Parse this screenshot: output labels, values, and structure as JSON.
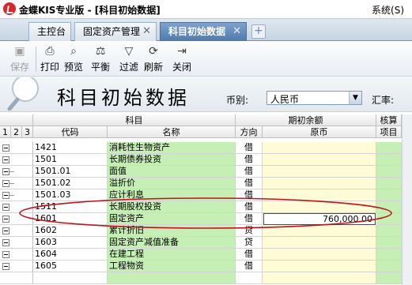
{
  "window": {
    "title": "金蝶KIS专业版 - [科目初始数据]",
    "system_menu": "系统(S)"
  },
  "tabs": [
    {
      "label": "主控台",
      "closable": false,
      "active": false
    },
    {
      "label": "固定资产管理",
      "closable": true,
      "active": false
    },
    {
      "label": "科目初始数据",
      "closable": true,
      "active": true
    }
  ],
  "toolbar": {
    "buttons": [
      {
        "label": "保存",
        "icon": "save-icon",
        "enabled": false
      },
      {
        "label": "打印",
        "icon": "print-icon",
        "enabled": true
      },
      {
        "label": "预览",
        "icon": "preview-icon",
        "enabled": true
      },
      {
        "label": "平衡",
        "icon": "balance-icon",
        "enabled": true
      },
      {
        "label": "过滤",
        "icon": "filter-icon",
        "enabled": true
      },
      {
        "label": "刷新",
        "icon": "refresh-icon",
        "enabled": true
      },
      {
        "label": "关闭",
        "icon": "close-door-icon",
        "enabled": true
      }
    ]
  },
  "header": {
    "page_title": "科目初始数据",
    "currency_label": "币别:",
    "currency_value": "人民币",
    "rate_label": "汇率:"
  },
  "grid": {
    "group_headers": {
      "subject": "科目",
      "opening_balance": "期初余额",
      "accounting": "核算"
    },
    "level_buttons": [
      "1",
      "2",
      "3"
    ],
    "columns": {
      "code": "代码",
      "name": "名称",
      "direction": "方向",
      "original_currency": "原币",
      "item": "项目"
    },
    "rows": [
      {
        "code": "1421",
        "name": "消耗性生物资产",
        "direction": "借",
        "amount": "",
        "level": 1,
        "expandable": true
      },
      {
        "code": "1501",
        "name": "长期债券投资",
        "direction": "借",
        "amount": "",
        "level": 1,
        "expandable": true
      },
      {
        "code": "1501.01",
        "name": "面值",
        "direction": "借",
        "amount": "",
        "level": 2,
        "expandable": false
      },
      {
        "code": "1501.02",
        "name": "溢折价",
        "direction": "借",
        "amount": "",
        "level": 2,
        "expandable": false
      },
      {
        "code": "1501.03",
        "name": "应计利息",
        "direction": "借",
        "amount": "",
        "level": 2,
        "expandable": false
      },
      {
        "code": "1511",
        "name": "长期股权投资",
        "direction": "借",
        "amount": "",
        "level": 1,
        "expandable": true
      },
      {
        "code": "1601",
        "name": "固定资产",
        "direction": "借",
        "amount": "760,000.00",
        "level": 1,
        "expandable": true,
        "editing": true
      },
      {
        "code": "1602",
        "name": "累计折旧",
        "direction": "贷",
        "amount": "",
        "level": 1,
        "expandable": true
      },
      {
        "code": "1603",
        "name": "固定资产减值准备",
        "direction": "贷",
        "amount": "",
        "level": 1,
        "expandable": true
      },
      {
        "code": "1604",
        "name": "在建工程",
        "direction": "借",
        "amount": "",
        "level": 1,
        "expandable": true
      },
      {
        "code": "1605",
        "name": "工程物资",
        "direction": "借",
        "amount": "",
        "level": 1,
        "expandable": true
      }
    ]
  },
  "colors": {
    "name_column_bg": "#c6efb5",
    "amount_column_bg": "#fffbd6",
    "annotation_ellipse": "#c0141c",
    "active_tab": "#5a82b4"
  }
}
